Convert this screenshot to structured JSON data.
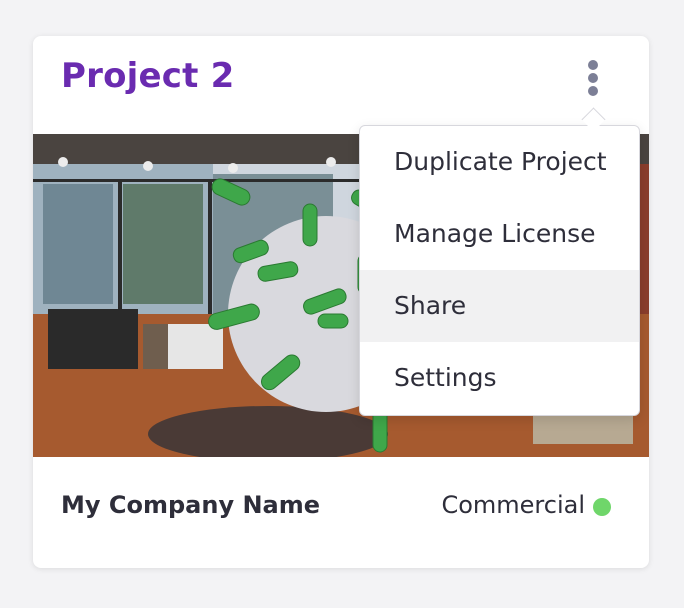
{
  "card": {
    "title": "Project 2",
    "company_name": "My Company Name",
    "license_type": "Commercial",
    "status_color": "#6fd66a",
    "accent_color": "#6a2bb0"
  },
  "menu": {
    "items": [
      {
        "label": "Duplicate Project"
      },
      {
        "label": "Manage License"
      },
      {
        "label": "Share",
        "highlighted": true
      },
      {
        "label": "Settings"
      }
    ]
  },
  "icons": {
    "more": "kebab-more-vertical-icon",
    "status": "status-dot-icon"
  }
}
